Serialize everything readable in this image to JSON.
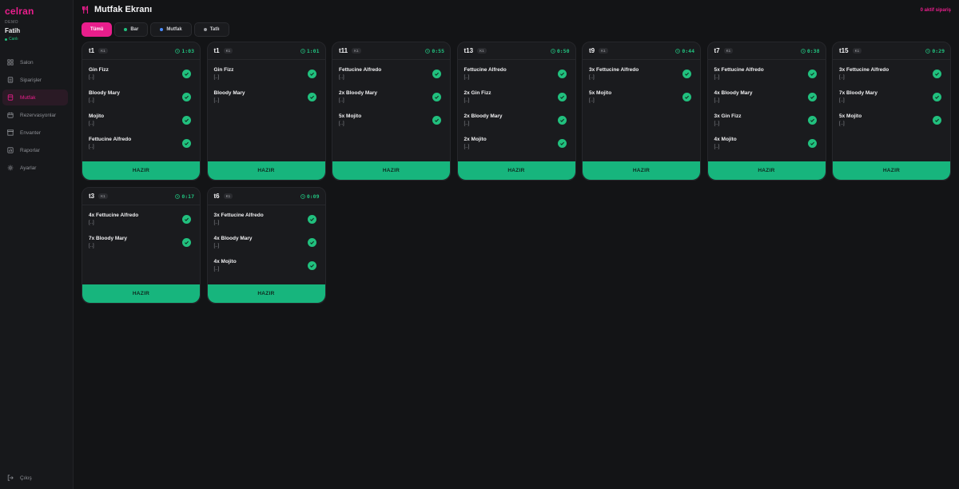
{
  "app": {
    "brand": "celran",
    "tenant": "DEMO",
    "user": "Fatih",
    "status": "Canlı"
  },
  "sidebar": {
    "items": [
      {
        "label": "Salon",
        "icon": "grid-icon"
      },
      {
        "label": "Siparişler",
        "icon": "orders-icon"
      },
      {
        "label": "Mutfak",
        "icon": "kitchen-icon",
        "active": true
      },
      {
        "label": "Rezervasyonlar",
        "icon": "calendar-icon"
      },
      {
        "label": "Envanter",
        "icon": "box-icon"
      },
      {
        "label": "Raporlar",
        "icon": "report-icon"
      },
      {
        "label": "Ayarlar",
        "icon": "gear-icon"
      }
    ],
    "logout": "Çıkış"
  },
  "header": {
    "title": "Mutfak Ekranı",
    "active_orders": "0 aktif sipariş"
  },
  "filters": [
    {
      "label": "Tümü",
      "active": true
    },
    {
      "label": "Bar",
      "dot": "#21c07e"
    },
    {
      "label": "Mutfak",
      "dot": "#4a8cff"
    },
    {
      "label": "Tatlı",
      "dot": "#9a9ca1"
    }
  ],
  "ready_label": "HAZIR",
  "orders": [
    {
      "table": "t1",
      "badge": "K1",
      "timer": "1:03",
      "items": [
        {
          "name": "Gin Fizz",
          "note": "[..]"
        },
        {
          "name": "Bloody Mary",
          "note": "[..]"
        },
        {
          "name": "Mojito",
          "note": "[..]"
        },
        {
          "name": "Fettucine Alfredo",
          "note": "[..]"
        }
      ]
    },
    {
      "table": "t1",
      "badge": "K1",
      "timer": "1:01",
      "items": [
        {
          "name": "Gin Fizz",
          "note": "[..]"
        },
        {
          "name": "Bloody Mary",
          "note": "[..]"
        }
      ]
    },
    {
      "table": "t11",
      "badge": "K1",
      "timer": "0:55",
      "items": [
        {
          "name": "Fettucine Alfredo",
          "note": "[..]"
        },
        {
          "name": "2x Bloody Mary",
          "note": "[..]"
        },
        {
          "name": "5x Mojito",
          "note": "[..]"
        }
      ]
    },
    {
      "table": "t13",
      "badge": "K1",
      "timer": "0:50",
      "items": [
        {
          "name": "Fettucine Alfredo",
          "note": "[..]"
        },
        {
          "name": "2x Gin Fizz",
          "note": "[..]"
        },
        {
          "name": "2x Bloody Mary",
          "note": "[..]"
        },
        {
          "name": "2x Mojito",
          "note": "[..]"
        }
      ]
    },
    {
      "table": "t9",
      "badge": "K1",
      "timer": "0:44",
      "items": [
        {
          "name": "3x Fettucine Alfredo",
          "note": "[..]"
        },
        {
          "name": "5x Mojito",
          "note": "[..]"
        }
      ]
    },
    {
      "table": "t7",
      "badge": "K1",
      "timer": "0:38",
      "items": [
        {
          "name": "5x Fettucine Alfredo",
          "note": "[..]"
        },
        {
          "name": "4x Bloody Mary",
          "note": "[..]"
        },
        {
          "name": "3x Gin Fizz",
          "note": "[..]"
        },
        {
          "name": "4x Mojito",
          "note": "[..]"
        }
      ]
    },
    {
      "table": "t15",
      "badge": "K1",
      "timer": "0:29",
      "items": [
        {
          "name": "3x Fettucine Alfredo",
          "note": "[..]"
        },
        {
          "name": "7x Bloody Mary",
          "note": "[..]"
        },
        {
          "name": "5x Mojito",
          "note": "[..]"
        }
      ]
    },
    {
      "table": "t3",
      "badge": "K1",
      "timer": "0:17",
      "items": [
        {
          "name": "4x Fettucine Alfredo",
          "note": "[..]"
        },
        {
          "name": "7x Bloody Mary",
          "note": "[..]"
        }
      ]
    },
    {
      "table": "t6",
      "badge": "K1",
      "timer": "0:09",
      "items": [
        {
          "name": "3x Fettucine Alfredo",
          "note": "[..]"
        },
        {
          "name": "4x Bloody Mary",
          "note": "[..]"
        },
        {
          "name": "4x Mojito",
          "note": "[..]"
        }
      ]
    }
  ]
}
